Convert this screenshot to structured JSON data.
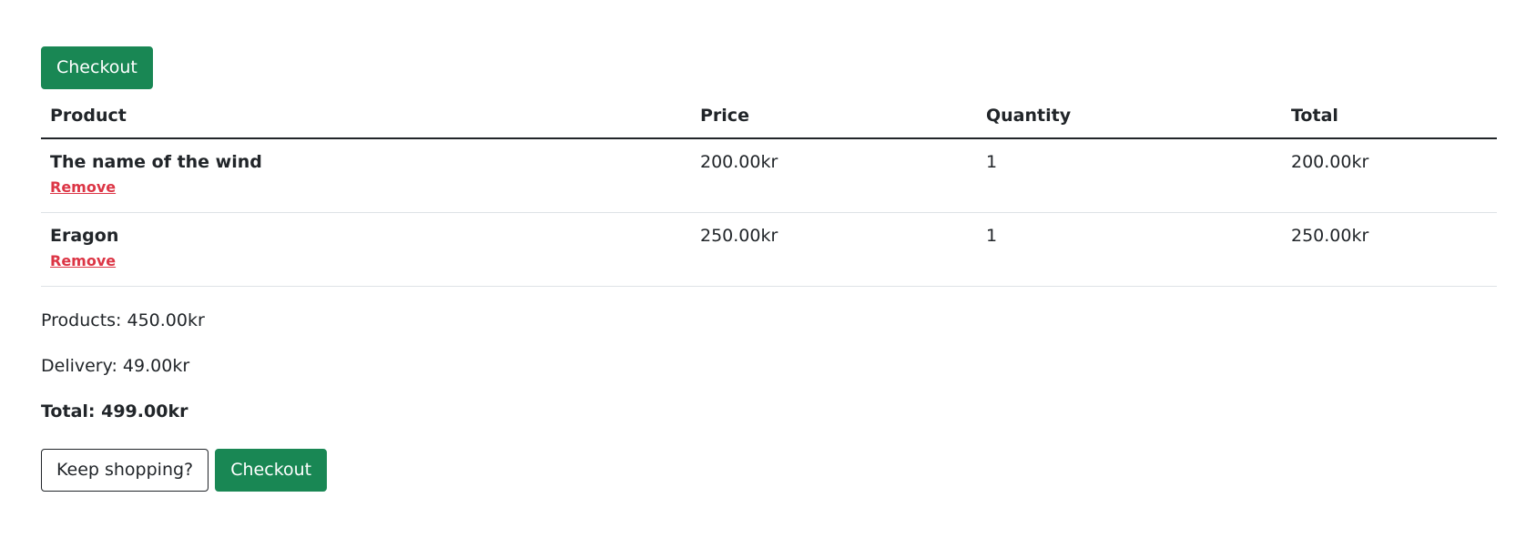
{
  "top": {
    "checkout_label": "Checkout"
  },
  "table": {
    "headers": {
      "product": "Product",
      "price": "Price",
      "quantity": "Quantity",
      "total": "Total"
    },
    "rows": [
      {
        "name": "The name of the wind",
        "remove_label": "Remove",
        "price": "200.00kr",
        "quantity": "1",
        "total": "200.00kr"
      },
      {
        "name": "Eragon",
        "remove_label": "Remove",
        "price": "250.00kr",
        "quantity": "1",
        "total": "250.00kr"
      }
    ]
  },
  "summary": {
    "products": "Products: 450.00kr",
    "delivery": "Delivery: 49.00kr",
    "total": "Total: 499.00kr"
  },
  "actions": {
    "keep_shopping_label": "Keep shopping?",
    "checkout_label": "Checkout"
  },
  "colors": {
    "primary_green": "#198754",
    "danger_red": "#dc3545"
  }
}
